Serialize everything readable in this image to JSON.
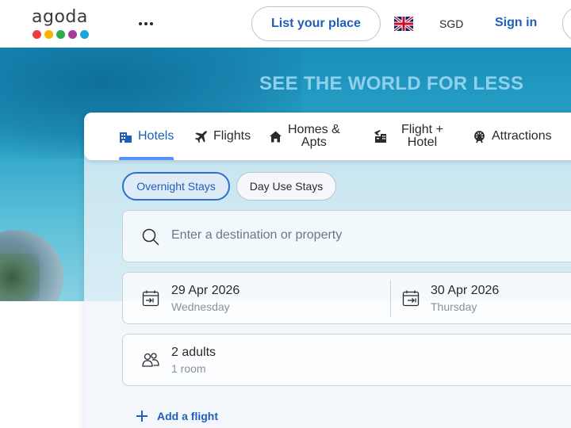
{
  "header": {
    "logo_text": "agoda",
    "logo_colors": [
      "#ee3c3c",
      "#f8b500",
      "#2bac4f",
      "#a63e98",
      "#1aa5dc"
    ],
    "more_icon": "more-horizontal-icon",
    "list_place_label": "List your place",
    "flag_icon": "uk-flag-icon",
    "currency": "SGD",
    "sign_in_label": "Sign in"
  },
  "hero": {
    "title": "SEE THE WORLD FOR LESS"
  },
  "tabs": [
    {
      "label": "Hotels",
      "icon": "hotel-icon",
      "active": true
    },
    {
      "label": "Flights",
      "icon": "airplane-icon",
      "active": false
    },
    {
      "label": "Homes & Apts",
      "line1": "Homes &",
      "line2": "Apts",
      "icon": "home-icon",
      "active": false
    },
    {
      "label": "Flight + Hotel",
      "line1": "Flight +",
      "line2": "Hotel",
      "icon": "flight-hotel-icon",
      "active": false
    },
    {
      "label": "Attractions",
      "icon": "ferris-wheel-icon",
      "active": false
    }
  ],
  "stay_types": {
    "overnight": "Overnight Stays",
    "day_use": "Day Use Stays",
    "selected": "Overnight Stays"
  },
  "search": {
    "placeholder": "Enter a destination or property",
    "value": ""
  },
  "dates": {
    "checkin_date": "29 Apr 2026",
    "checkin_day": "Wednesday",
    "checkout_date": "30 Apr 2026",
    "checkout_day": "Thursday"
  },
  "occupancy": {
    "guests": "2 adults",
    "rooms": "1 room"
  },
  "add_flight_label": "Add a flight",
  "colors": {
    "brand_blue": "#1f5fb8",
    "accent_blue": "#5392f9",
    "hero_title": "#8fd0ec"
  }
}
